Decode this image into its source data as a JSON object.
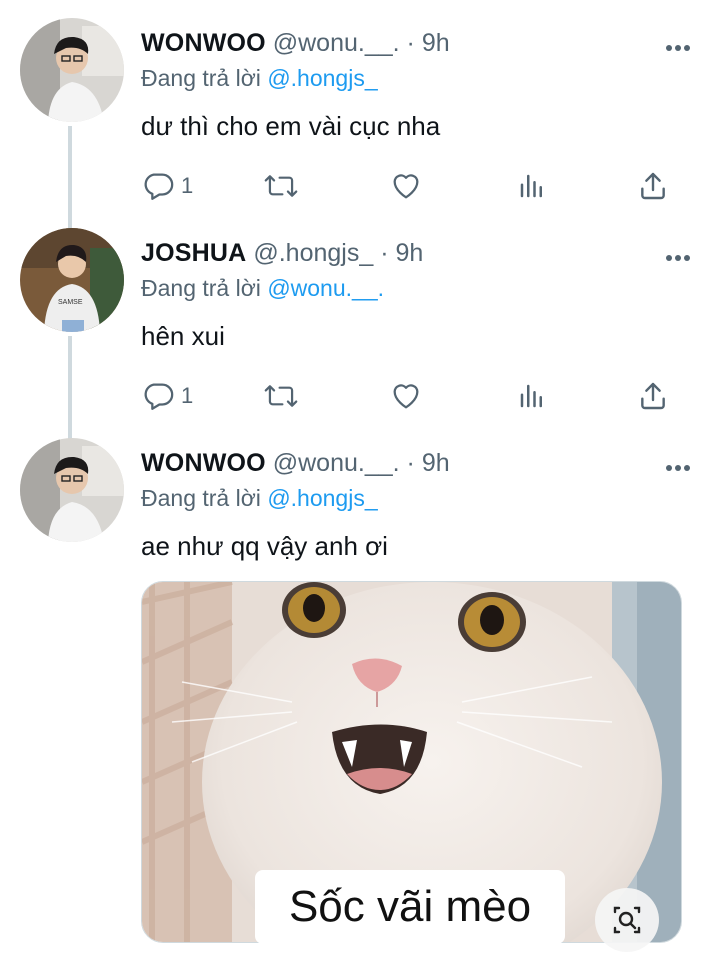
{
  "colors": {
    "link": "#1d9bf0",
    "secondary_text": "#536471",
    "thread_line": "#cfd9de"
  },
  "tweets": [
    {
      "name": "WONWOO",
      "handle": "@wonu.__.",
      "dot": "·",
      "time": "9h",
      "replying_prefix": "Đang trả lời",
      "replying_to": "@.hongjs_",
      "text": "dư thì cho em vài cục nha",
      "actions": {
        "reply_count": "1"
      },
      "avatar": "avatar-wonwoo"
    },
    {
      "name": "JOSHUA",
      "handle": "@.hongjs_",
      "dot": "·",
      "time": "9h",
      "replying_prefix": "Đang trả lời",
      "replying_to": "@wonu.__.",
      "text": "hên xui",
      "actions": {
        "reply_count": "1"
      },
      "avatar": "avatar-joshua"
    },
    {
      "name": "WONWOO",
      "handle": "@wonu.__.",
      "dot": "·",
      "time": "9h",
      "replying_prefix": "Đang trả lời",
      "replying_to": "@.hongjs_",
      "text": "ae như qq vậy anh ơi",
      "media": {
        "caption": "Sốc vãi mèo",
        "description_icon": "image-search-icon"
      },
      "avatar": "avatar-wonwoo"
    }
  ],
  "icons": [
    "reply-icon",
    "retweet-icon",
    "like-icon",
    "views-icon",
    "share-icon",
    "more-icon",
    "image-search-icon"
  ]
}
